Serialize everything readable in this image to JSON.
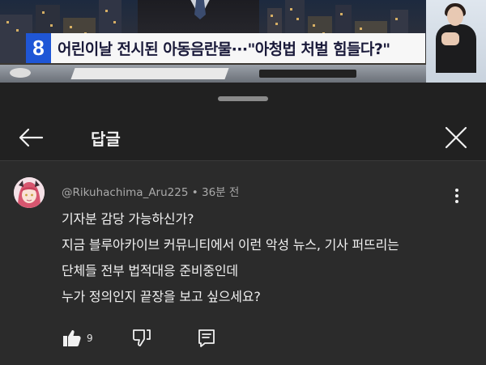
{
  "video": {
    "channel_badge": "8",
    "caption": "어린이날 전시된 아동음란물···\"아청법 처벌 힘들다?\""
  },
  "sheet": {
    "title": "답글",
    "icons": {
      "back": "back-arrow-icon",
      "close": "close-icon"
    }
  },
  "comment": {
    "author": "@Rikuhachima_Aru225",
    "separator": " • ",
    "time": "36분 전",
    "lines": [
      "기자분 감당 가능하신가?",
      "지금 블루아카이브 커뮤니티에서 이런 악성 뉴스, 기사 퍼뜨리는",
      "단체들 전부 법적대응 준비중인데",
      "누가 정의인지 끝장을 보고 싶으세요?"
    ],
    "like_count": "9",
    "icons": {
      "more": "more-vert-icon",
      "like": "thumbs-up-icon",
      "dislike": "thumbs-down-icon",
      "reply": "reply-icon"
    }
  },
  "colors": {
    "background": "#212121",
    "comment_background": "#2b2b2b",
    "text": "#f1f1f1",
    "meta_text": "#aaaaaa",
    "channel_badge": "#1f56d6"
  }
}
